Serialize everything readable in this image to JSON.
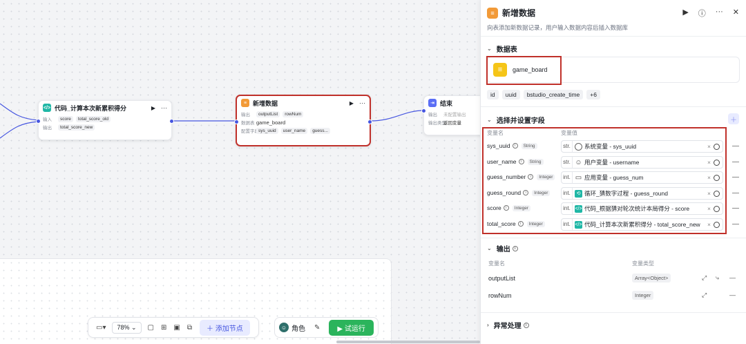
{
  "canvas": {
    "node_code": {
      "title": "代码_计算本次新累积得分",
      "input_label": "输入",
      "inputs": [
        "score",
        "total_score_old"
      ],
      "output_label": "输出",
      "outputs": [
        "total_score_new"
      ]
    },
    "node_add": {
      "title": "新增数据",
      "output_label": "输出",
      "outputs": [
        "outputList",
        "rowNum"
      ],
      "table_label": "数据表",
      "table": "game_board",
      "fields_label": "配置字段",
      "fields": [
        "sys_uuid",
        "user_name",
        "guess..."
      ]
    },
    "node_end": {
      "title": "结束",
      "output_label": "输出",
      "output_value": "未配置输出",
      "type_label": "输出类型",
      "type_value": "返回变量"
    },
    "toolbar": {
      "zoom": "78%",
      "add_node": "添加节点",
      "role": "角色",
      "run": "试运行"
    }
  },
  "panel": {
    "title": "新增数据",
    "description": "向表添加新数据记录，用户输入数据内容后插入数据库",
    "table_section": "数据表",
    "table_name": "game_board",
    "columns": [
      "id",
      "uuid",
      "bstudio_create_time",
      "+6"
    ],
    "fields_section": "选择并设置字段",
    "col_var_name": "变量名",
    "col_var_value": "变量值",
    "fields": [
      {
        "name": "sys_uuid",
        "type": "String",
        "prefix": "str.",
        "value": "系统变量 - sys_uuid",
        "icon": "gear-icon"
      },
      {
        "name": "user_name",
        "type": "String",
        "prefix": "str.",
        "value": "用户变量 - username",
        "icon": "user-icon"
      },
      {
        "name": "guess_number",
        "type": "Integer",
        "prefix": "int.",
        "value": "应用变量 - guess_num",
        "icon": "folder-icon"
      },
      {
        "name": "guess_round",
        "type": "Integer",
        "prefix": "int.",
        "value": "循环_猜数字过程 - guess_round",
        "icon": "loop-icon"
      },
      {
        "name": "score",
        "type": "Integer",
        "prefix": "int.",
        "value": "代码_根据猜对轮次统计本局得分 - score",
        "icon": "code-icon"
      },
      {
        "name": "total_score",
        "type": "Integer",
        "prefix": "int.",
        "value": "代码_计算本次新累积得分 - total_score_new",
        "icon": "code-icon"
      }
    ],
    "output_section": "输出",
    "out_col_name": "变量名",
    "out_col_type": "变量类型",
    "outputs": [
      {
        "name": "outputList",
        "type": "Array<Object>"
      },
      {
        "name": "rowNum",
        "type": "Integer"
      }
    ],
    "error_section": "异常处理"
  },
  "colors": {
    "accent": "#4656e0",
    "highlight": "#c0302a",
    "run": "#2bb45c"
  }
}
